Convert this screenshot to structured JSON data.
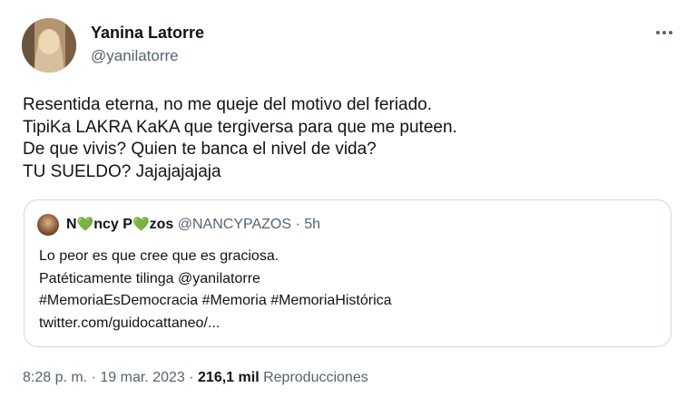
{
  "author": {
    "name": "Yanina Latorre",
    "handle": "@yanilatorre"
  },
  "tweet": {
    "lines": [
      "Resentida eterna, no me queje del motivo del feriado.",
      "TipiKa LAKRA KaKA que tergiversa para que me puteen.",
      "De que vivis? Quien te banca el nivel de vida?",
      "TU SUELDO? Jajajajajaja"
    ]
  },
  "quoted": {
    "name_part1": "N",
    "name_part2": "ncy P",
    "name_part3": "zos",
    "heart": "💚",
    "handle": "@NANCYPAZOS",
    "separator": "·",
    "time": "5h",
    "lines": [
      "Lo peor es que cree que es graciosa.",
      "Patéticamente tilinga @yanilatorre",
      "#MemoriaEsDemocracia #Memoria #MemoriaHistórica",
      "twitter.com/guidocattaneo/..."
    ]
  },
  "meta": {
    "time": "8:28 p. m.",
    "sep1": "·",
    "date": "19 mar. 2023",
    "sep2": "·",
    "views_count": "216,1 mil",
    "views_label": "Reproducciones"
  }
}
